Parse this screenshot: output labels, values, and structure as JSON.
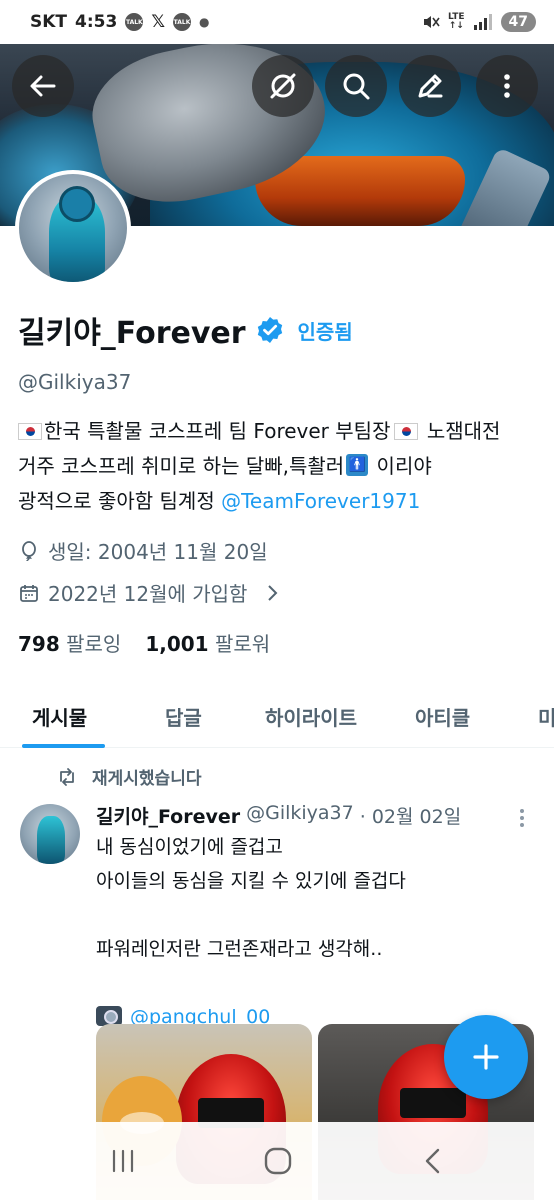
{
  "status_bar": {
    "carrier": "SKT",
    "time": "4:53",
    "talk_icon_text": "TALK",
    "x_logo": "𝕏",
    "network": "LTE",
    "battery": "47"
  },
  "profile": {
    "name": "길키야_Forever",
    "verified_label": "인증됨",
    "handle": "@Gilkiya37",
    "bio_line1": "한국 특촬물 코스프레 팀 Forever 부팀장",
    "bio_line1_tail": " 노잼대전",
    "bio_line2": "거주 코스프레 취미로 하는 달빠,특촬러",
    "bio_line2_tail": " 이리야",
    "bio_line3": "광적으로 좋아함 팀계정 ",
    "bio_link": "@TeamForever1971",
    "birthday": "생일: 2004년 11월 20일",
    "joined": "2022년 12월에 가입함",
    "following_count": "798",
    "following_label": "팔로잉",
    "followers_count": "1,001",
    "followers_label": "팔로워"
  },
  "tabs": [
    {
      "label": "게시물"
    },
    {
      "label": "답글"
    },
    {
      "label": "하이라이트"
    },
    {
      "label": "아티클"
    },
    {
      "label": "미"
    }
  ],
  "post": {
    "repost_label": "재게시했습니다",
    "author_name": "길키야_Forever",
    "author_handle": "@Gilkiya37",
    "date": "· 02월 02일",
    "lines": [
      "내 동심이었기에 즐겁고",
      "아이들의 동심을 지킬 수 있기에 즐겁다",
      "",
      "파워레인저란 그런존재라고 생각해..",
      ""
    ],
    "photo_credit": "@pangchul_00"
  },
  "colors": {
    "accent": "#1d9bf0",
    "text": "#0f1419",
    "secondary_text": "#536471"
  }
}
